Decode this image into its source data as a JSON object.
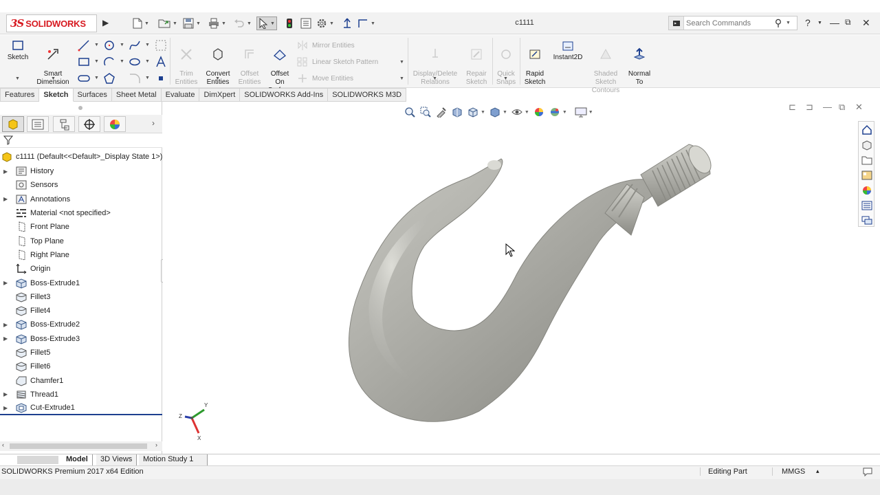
{
  "app": {
    "name": "SOLIDWORKS",
    "logo_prefix": "3S",
    "document_title": "c1111"
  },
  "search": {
    "placeholder": "Search Commands"
  },
  "help_label": "?",
  "ribbon": {
    "sketch": "Sketch",
    "smart_dimension": "Smart\nDimension",
    "trim_entities": "Trim\nEntities",
    "convert_entities": "Convert\nEntities",
    "offset_entities": "Offset\nEntities",
    "offset_on_surface": "Offset\nOn\nSurface",
    "mirror_entities": "Mirror Entities",
    "linear_sketch_pattern": "Linear Sketch Pattern",
    "move_entities": "Move Entities",
    "display_delete_relations": "Display/Delete\nRelations",
    "repair_sketch": "Repair\nSketch",
    "quick_snaps": "Quick\nSnaps",
    "rapid_sketch": "Rapid\nSketch",
    "instant2d": "Instant2D",
    "shaded_sketch_contours": "Shaded\nSketch\nContours",
    "normal_to": "Normal\nTo"
  },
  "command_tabs": [
    "Features",
    "Sketch",
    "Surfaces",
    "Sheet Metal",
    "Evaluate",
    "DimXpert",
    "SOLIDWORKS Add-Ins",
    "SOLIDWORKS M3D"
  ],
  "active_tab": "Sketch",
  "feature_manager": {
    "root_label": "c1111 (Default<<Default>_Display State 1>)",
    "tree": [
      {
        "label": "History",
        "icon": "history-icon",
        "expandable": true
      },
      {
        "label": "Sensors",
        "icon": "sensors-icon",
        "expandable": false
      },
      {
        "label": "Annotations",
        "icon": "annotations-icon",
        "expandable": true
      },
      {
        "label": "Material <not specified>",
        "icon": "material-icon",
        "expandable": false
      },
      {
        "label": "Front Plane",
        "icon": "plane-icon",
        "expandable": false
      },
      {
        "label": "Top Plane",
        "icon": "plane-icon",
        "expandable": false
      },
      {
        "label": "Right Plane",
        "icon": "plane-icon",
        "expandable": false
      },
      {
        "label": "Origin",
        "icon": "origin-icon",
        "expandable": false
      },
      {
        "label": "Boss-Extrude1",
        "icon": "extrude-icon",
        "expandable": true
      },
      {
        "label": "Fillet3",
        "icon": "fillet-icon",
        "expandable": false
      },
      {
        "label": "Fillet4",
        "icon": "fillet-icon",
        "expandable": false
      },
      {
        "label": "Boss-Extrude2",
        "icon": "extrude-icon",
        "expandable": true
      },
      {
        "label": "Boss-Extrude3",
        "icon": "extrude-icon",
        "expandable": true
      },
      {
        "label": "Fillet5",
        "icon": "fillet-icon",
        "expandable": false
      },
      {
        "label": "Fillet6",
        "icon": "fillet-icon",
        "expandable": false
      },
      {
        "label": "Chamfer1",
        "icon": "chamfer-icon",
        "expandable": false
      },
      {
        "label": "Thread1",
        "icon": "thread-icon",
        "expandable": true
      },
      {
        "label": "Cut-Extrude1",
        "icon": "cut-extrude-icon",
        "expandable": true
      }
    ]
  },
  "bottom_tabs": [
    "Model",
    "3D Views",
    "Motion Study 1"
  ],
  "status_bar": {
    "edition": "SOLIDWORKS Premium 2017 x64 Edition",
    "mode": "Editing Part",
    "units": "MMGS",
    "units_arrow": "▴"
  },
  "triad": {
    "x": "X",
    "y": "Y",
    "z": "Z"
  },
  "colors": {
    "brand_red": "#d71920",
    "model_gray": "#a9a9a4",
    "accent_blue": "#1d3f8f"
  }
}
